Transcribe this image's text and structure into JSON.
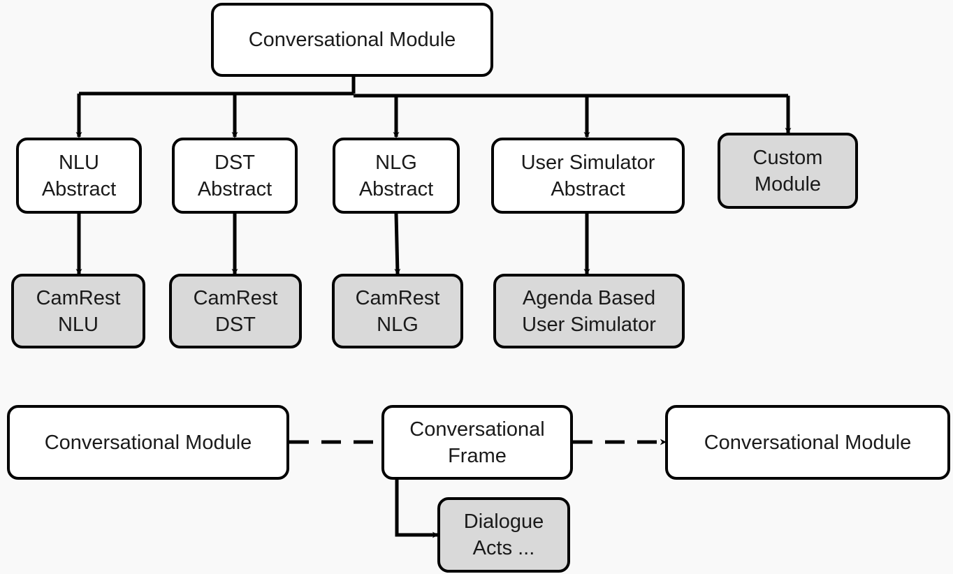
{
  "top": {
    "root": "Conversational Module",
    "abstracts": [
      {
        "label": "NLU\nAbstract"
      },
      {
        "label": "DST\nAbstract"
      },
      {
        "label": "NLG\nAbstract"
      },
      {
        "label": "User Simulator\nAbstract"
      }
    ],
    "custom": "Custom\nModule",
    "implementations": [
      {
        "label": "CamRest\nNLU"
      },
      {
        "label": "CamRest\nDST"
      },
      {
        "label": "CamRest\nNLG"
      },
      {
        "label": "Agenda Based\nUser Simulator"
      }
    ]
  },
  "bottom": {
    "source": "Conversational Module",
    "frame": "Conversational\nFrame",
    "target": "Conversational Module",
    "payload": "Dialogue\nActs ..."
  },
  "colors": {
    "abstract_fill": "#ffffff",
    "concrete_fill": "#d9d9d9",
    "stroke": "#000000"
  }
}
